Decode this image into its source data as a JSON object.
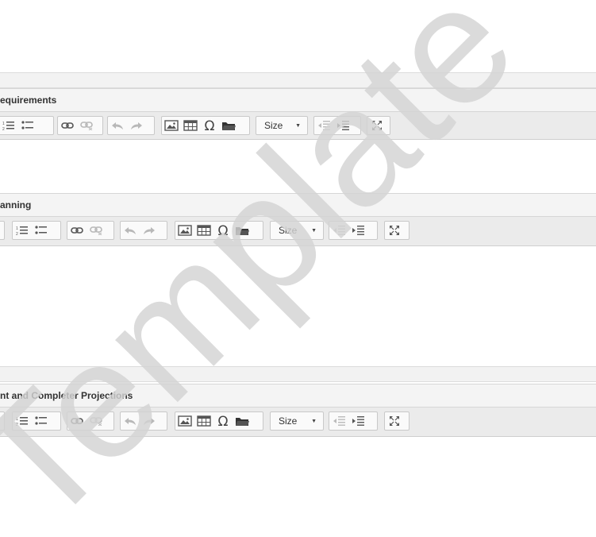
{
  "editors": [
    {
      "title": "equirements",
      "size_label": "Size"
    },
    {
      "title": "anning",
      "size_label": "Size"
    },
    {
      "title": "nt and Completer Projections",
      "size_label": "Size"
    }
  ],
  "watermark": {
    "text": "Template",
    "color": "#d3d3d3"
  }
}
